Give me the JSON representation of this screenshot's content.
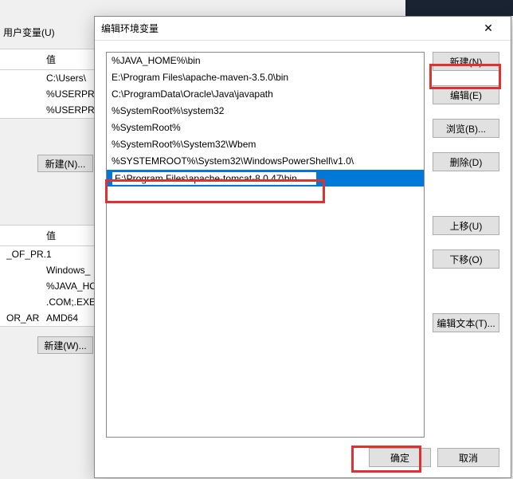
{
  "bg": {
    "user_vars_label": "用户变量(U)",
    "value_header": "值",
    "user_rows": [
      "C:\\Users\\",
      "%USERPR",
      "%USERPR"
    ],
    "new_btn_n": "新建(N)...",
    "sys_header": "值",
    "sys_rows_left": [
      "_OF_PR...",
      "",
      "",
      "",
      "OR_AR"
    ],
    "sys_rows": [
      "1",
      "Windows_",
      "%JAVA_HO",
      ".COM;.EXE",
      "AMD64"
    ],
    "new_btn_w": "新建(W)..."
  },
  "dialog": {
    "title": "编辑环境变量",
    "items": [
      "%JAVA_HOME%\\bin",
      "E:\\Program Files\\apache-maven-3.5.0\\bin",
      "C:\\ProgramData\\Oracle\\Java\\javapath",
      "%SystemRoot%\\system32",
      "%SystemRoot%",
      "%SystemRoot%\\System32\\Wbem",
      "%SYSTEMROOT%\\System32\\WindowsPowerShell\\v1.0\\"
    ],
    "editing_value": "E:\\Program Files\\apache-tomcat-8.0.47\\bin",
    "buttons": {
      "new": "新建(N)",
      "edit": "编辑(E)",
      "browse": "浏览(B)...",
      "delete": "删除(D)",
      "moveup": "上移(U)",
      "movedown": "下移(O)",
      "edittext": "编辑文本(T)..."
    },
    "footer": {
      "ok": "确定",
      "cancel": "取消"
    }
  }
}
